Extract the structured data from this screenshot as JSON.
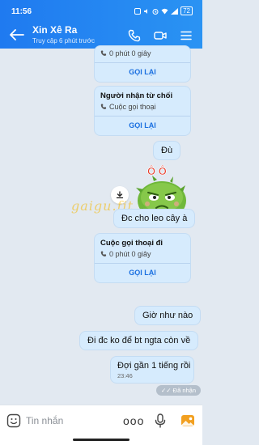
{
  "status": {
    "time": "11:56",
    "battery": "72"
  },
  "header": {
    "title": "Xin Xê Ra",
    "subtitle": "Truy cập 6 phút trước"
  },
  "messages": {
    "card1": {
      "duration": "0 phút 0 giây",
      "action": "GỌI LẠI"
    },
    "card2": {
      "title": "Người nhận từ chối",
      "status": "Cuộc gọi thoại",
      "action": "GỌI LẠI"
    },
    "msg_du": "Đù",
    "sticker_text": "Ô Ô",
    "watermark": "gaigu.fit",
    "msg_cho_leo": "Đc cho leo cây à",
    "card3": {
      "title": "Cuộc gọi thoại đi",
      "duration": "0 phút 0 giây",
      "action": "GỌI LẠI"
    },
    "msg_gio": "Giờ như nào",
    "msg_di": "Đi đc ko để bt ngta còn về",
    "msg_doi": "Đợi gần 1 tiếng rồi",
    "time_last": "23:46",
    "seen": "Đã nhận"
  },
  "input": {
    "placeholder": "Tin nhắn",
    "more": "ooo"
  },
  "colors": {
    "header": "#1f7af0",
    "bubble": "#d6ebfd",
    "accent": "#1a6fe0",
    "background": "#e2e9f1"
  }
}
